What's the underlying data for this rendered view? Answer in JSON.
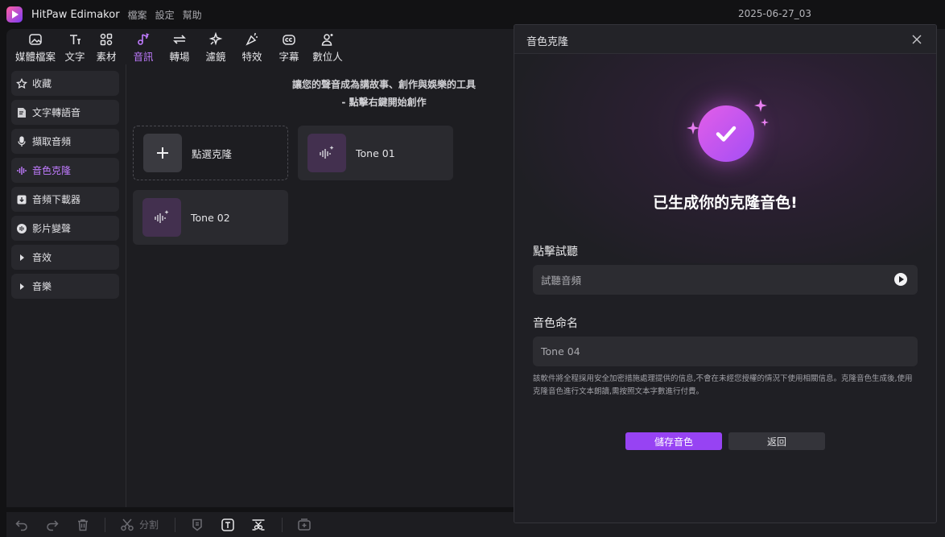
{
  "titlebar": {
    "app_name": "HitPaw Edimakor",
    "menu": [
      "檔案",
      "設定",
      "幫助"
    ],
    "project_name": "2025-06-27_03"
  },
  "toolbar": {
    "tabs": [
      {
        "label": "媒體檔案",
        "icon": "media-icon"
      },
      {
        "label": "文字",
        "icon": "text-icon"
      },
      {
        "label": "素材",
        "icon": "elements-icon"
      },
      {
        "label": "音訊",
        "icon": "audio-icon",
        "active": true
      },
      {
        "label": "轉場",
        "icon": "transition-icon"
      },
      {
        "label": "濾鏡",
        "icon": "filter-icon"
      },
      {
        "label": "特效",
        "icon": "effects-icon"
      },
      {
        "label": "字幕",
        "icon": "subtitle-icon"
      },
      {
        "label": "數位人",
        "icon": "avatar-icon"
      }
    ]
  },
  "sidebar": {
    "items": [
      {
        "label": "收藏",
        "icon": "star-icon"
      },
      {
        "label": "文字轉語音",
        "icon": "text-to-speech-icon"
      },
      {
        "label": "擷取音頻",
        "icon": "microphone-icon"
      },
      {
        "label": "音色克隆",
        "icon": "voice-clone-icon",
        "active": true
      },
      {
        "label": "音頻下載器",
        "icon": "download-icon"
      },
      {
        "label": "影片變聲",
        "icon": "voice-changer-icon"
      },
      {
        "label": "音效",
        "icon": "caret-right-icon"
      },
      {
        "label": "音樂",
        "icon": "caret-right-icon"
      }
    ]
  },
  "content": {
    "promo_line1": "讓您的聲音成為講故事、創作與娛樂的工具",
    "promo_line2": "- 點擊右鍵開始創作",
    "cards": {
      "add": "點選克隆",
      "tone1": "Tone 01",
      "tone2": "Tone 02"
    }
  },
  "bottombar": {
    "split_label": "分割"
  },
  "dialog": {
    "title": "音色克隆",
    "heading": "已生成你的克隆音色!",
    "preview_label": "點擊試聽",
    "preview_field": "試聽音頻",
    "name_label": "音色命名",
    "name_value": "Tone 04",
    "disclaimer": "該軟件將全程採用安全加密措施處理提供的信息,不會在未經您授權的情況下使用相關信息。克隆音色生成後,使用克隆音色進行文本朗讀,需按照文本字數進行付費。",
    "save_label": "儲存音色",
    "back_label": "返回"
  },
  "colors": {
    "accent": "#9743f3",
    "active_text": "#c07bff"
  }
}
